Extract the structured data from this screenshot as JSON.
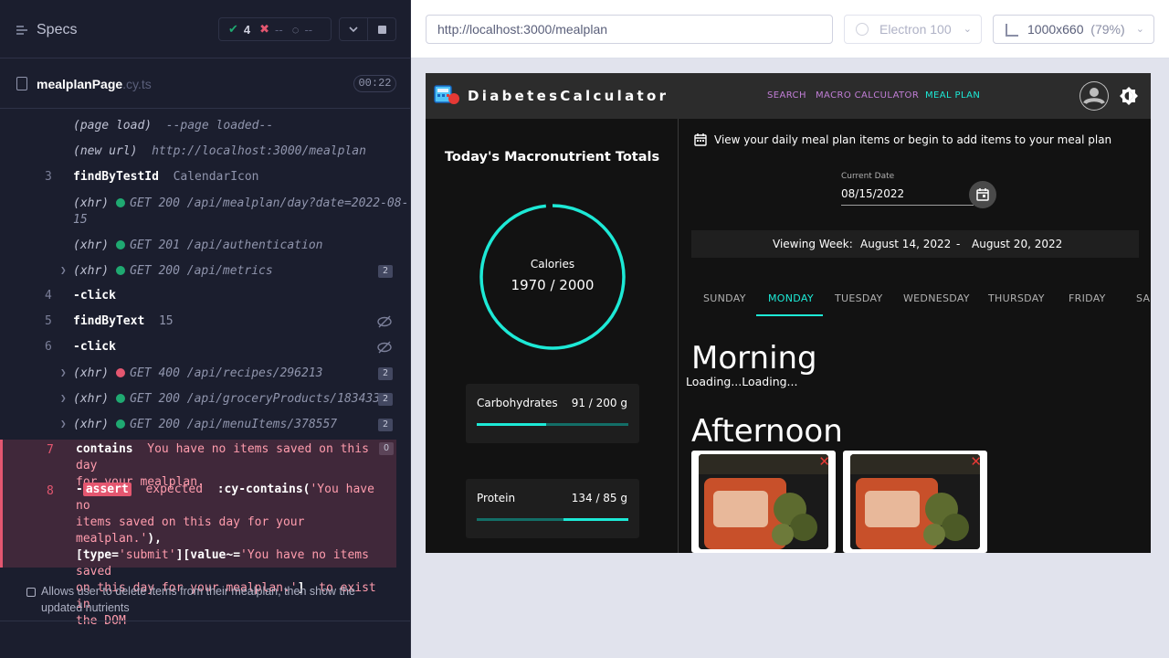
{
  "specs": {
    "title": "Specs",
    "stats": {
      "passed": "4",
      "failed": "--",
      "pending": "--"
    }
  },
  "spec_file": {
    "name": "mealplanPage",
    "ext": ".cy.ts",
    "duration": "00:22"
  },
  "commands": [
    {
      "num": "",
      "name": "(page load)",
      "message": "--page loaded--"
    },
    {
      "num": "",
      "name": "(new url)",
      "message": "http://localhost:3000/mealplan"
    },
    {
      "num": "3",
      "name": "findByTestId",
      "message": "CalendarIcon"
    },
    {
      "num": "",
      "name": "(xhr)",
      "method": "GET",
      "status": "200",
      "url": "/api/mealplan/day?date=2022-08-",
      "url_cont": "15"
    },
    {
      "num": "",
      "name": "(xhr)",
      "method": "GET",
      "status": "201",
      "url": "/api/authentication"
    },
    {
      "num": "",
      "name": "(xhr)",
      "method": "GET",
      "status": "200",
      "url": "/api/metrics",
      "count": "2"
    },
    {
      "num": "4",
      "name": "-click",
      "message": ""
    },
    {
      "num": "5",
      "name": "findByText",
      "message": "15"
    },
    {
      "num": "6",
      "name": "-click",
      "message": ""
    },
    {
      "num": "",
      "name": "(xhr)",
      "method": "GET",
      "status": "400",
      "url": "/api/recipes/296213",
      "count": "2"
    },
    {
      "num": "",
      "name": "(xhr)",
      "method": "GET",
      "status": "200",
      "url": "/api/groceryProducts/183433",
      "count": "2"
    },
    {
      "num": "",
      "name": "(xhr)",
      "method": "GET",
      "status": "200",
      "url": "/api/menuItems/378557",
      "count": "2"
    }
  ],
  "error": {
    "contains_num": "7",
    "contains_name": "contains",
    "contains_msg_1": "You have no items saved on this day",
    "contains_msg_2": "for your mealplan.",
    "contains_count": "0",
    "assert_num": "8",
    "assert_dash": "-",
    "assert_tag": "assert",
    "assert_l1_a": "expected",
    "assert_l1_b": ":cy-contains(",
    "assert_l1_c": "'You have no",
    "assert_l2_a": "items saved on this day for your mealplan.'",
    "assert_l2_b": "),",
    "assert_l3_a": "[type=",
    "assert_l3_b": "'submit'",
    "assert_l3_c": "][value~=",
    "assert_l3_d": "'You have no items saved",
    "assert_l4_a": "on this day for your mealplan.'",
    "assert_l4_b": "]",
    "assert_l4_c": "to exist in",
    "assert_l5": "the DOM"
  },
  "test_item": "Allows user to delete items from their mealplan, then show the updated nutrients",
  "browser": {
    "url": "http://localhost:3000/mealplan",
    "browser_name": "Electron 100",
    "viewport": "1000x660",
    "zoom": "(79%)"
  },
  "app": {
    "title": "DiabetesCalculator",
    "nav": [
      "SEARCH",
      "MACRO CALCULATOR",
      "MEAL PLAN"
    ],
    "accent": "#1de9d6",
    "nav_color": "#c17ed6",
    "totals_title": "Today's Macronutrient Totals",
    "calories_label": "Calories",
    "calories_value": "1970 / 2000",
    "calories_fraction": 0.985,
    "macros": [
      {
        "name": "Carbohydrates",
        "value": "91 / 200 g",
        "fraction": 0.455
      },
      {
        "name": "Protein",
        "value": "134 / 85 g",
        "fraction": 1.0
      }
    ],
    "intro": "View your daily meal plan items or begin to add items to your meal plan",
    "date_label": "Current Date",
    "date_value": "08/15/2022",
    "week_prefix": "Viewing Week:",
    "week_start": "August 14, 2022",
    "week_sep": "-",
    "week_end": "August 20, 2022",
    "tabs": [
      "SUNDAY",
      "MONDAY",
      "TUESDAY",
      "WEDNESDAY",
      "THURSDAY",
      "FRIDAY",
      "SA"
    ],
    "selected_tab": "MONDAY",
    "morning": "Morning",
    "loading": "Loading...Loading...",
    "afternoon": "Afternoon",
    "delete_icon": "close-icon"
  }
}
